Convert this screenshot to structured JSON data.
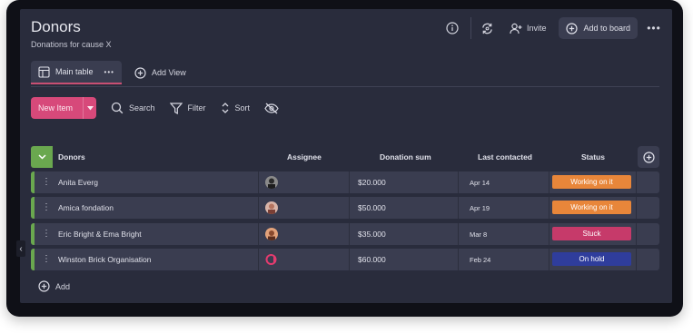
{
  "header": {
    "title": "Donors",
    "subtitle": "Donations for cause X",
    "invite_label": "Invite",
    "add_to_board_label": "Add to board"
  },
  "tabs": {
    "main_table_label": "Main table",
    "add_view_label": "Add View"
  },
  "toolbar": {
    "new_item_label": "New Item",
    "search_label": "Search",
    "filter_label": "Filter",
    "sort_label": "Sort"
  },
  "table": {
    "columns": [
      "Donors",
      "Assignee",
      "Donation sum",
      "Last contacted",
      "Status"
    ],
    "rows": [
      {
        "name": "Anita Everg",
        "sum": "$20.000",
        "date": "Apr 14",
        "status": "Working on it",
        "status_color": "#e8863a"
      },
      {
        "name": "Amica fondation",
        "sum": "$50.000",
        "date": "Apr 19",
        "status": "Working on it",
        "status_color": "#e8863a"
      },
      {
        "name": "Eric Bright & Ema Bright",
        "sum": "$35.000",
        "date": "Mar 8",
        "status": "Stuck",
        "status_color": "#c63a6a"
      },
      {
        "name": "Winston Brick Organisation",
        "sum": "$60.000",
        "date": "Feb 24",
        "status": "On hold",
        "status_color": "#2f3d9c"
      }
    ],
    "add_label": "Add"
  },
  "colors": {
    "accent_pink": "#d7497a",
    "group_green": "#6aa84f"
  }
}
